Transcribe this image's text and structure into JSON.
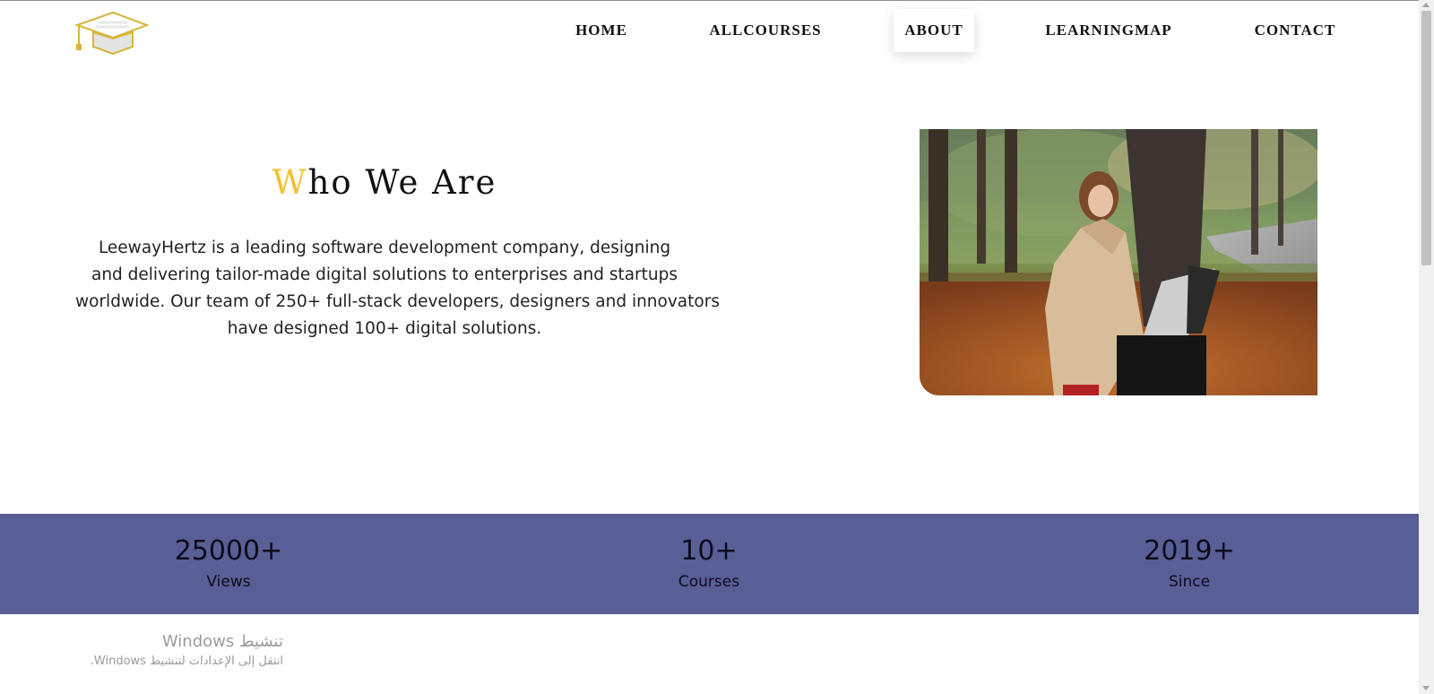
{
  "header": {
    "logo_icon": "graduation-cap-icon",
    "nav": {
      "home": "HOME",
      "all_courses": "ALLCOURSES",
      "about": "ABOUT",
      "learning_map": "LEARNINGMAP",
      "contact": "CONTACT"
    },
    "active_nav": "ABOUT"
  },
  "about": {
    "title_first_letter": "W",
    "title_rest": "ho We Are",
    "description_lines": [
      "LeewayHertz is a leading software development company, designing",
      "and delivering tailor-made digital solutions to enterprises and startups",
      "worldwide. Our team of 250+ full-stack developers, designers and innovators",
      "have designed 100+ digital solutions."
    ]
  },
  "stats": [
    {
      "value": "25000+",
      "label": "Views"
    },
    {
      "value": "10+",
      "label": "Courses"
    },
    {
      "value": "2019+",
      "label": "Since"
    }
  ],
  "windows_activation": {
    "title": "تنشيط Windows",
    "subtitle": "انتقل إلى الإعدادات لتنشيط Windows."
  },
  "colors": {
    "accent_yellow": "#f1c232",
    "stats_band": "#585e96",
    "text_dark": "#111111"
  }
}
